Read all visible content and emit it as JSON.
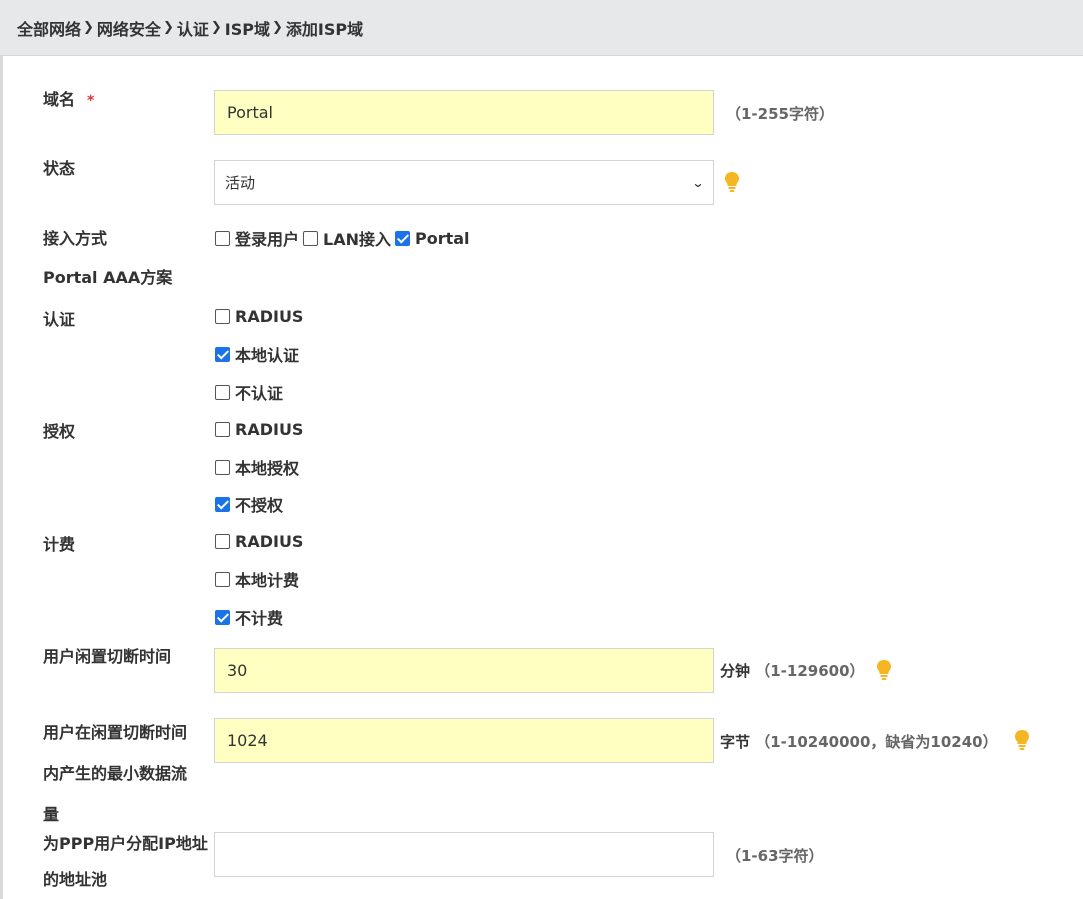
{
  "breadcrumb": [
    "全部网络",
    "网络安全",
    "认证",
    "ISP域",
    "添加ISP域"
  ],
  "breadcrumb_separator": "❯",
  "domain_name": {
    "label": "域名",
    "required_mark": "*",
    "value": "Portal",
    "hint": "（1-255字符）"
  },
  "status": {
    "label": "状态",
    "selected": "活动"
  },
  "access_method": {
    "label": "接入方式",
    "options": [
      {
        "label": "登录用户",
        "checked": false
      },
      {
        "label": "LAN接入",
        "checked": false
      },
      {
        "label": "Portal",
        "checked": true
      }
    ]
  },
  "portal_aaa": {
    "label": "Portal AAA方案"
  },
  "authentication": {
    "label": "认证",
    "options": [
      {
        "label": "RADIUS",
        "checked": false
      },
      {
        "label": "本地认证",
        "checked": true
      },
      {
        "label": "不认证",
        "checked": false
      }
    ]
  },
  "authorization": {
    "label": "授权",
    "options": [
      {
        "label": "RADIUS",
        "checked": false
      },
      {
        "label": "本地授权",
        "checked": false
      },
      {
        "label": "不授权",
        "checked": true
      }
    ]
  },
  "accounting": {
    "label": "计费",
    "options": [
      {
        "label": "RADIUS",
        "checked": false
      },
      {
        "label": "本地计费",
        "checked": false
      },
      {
        "label": "不计费",
        "checked": true
      }
    ]
  },
  "idle_cut_time": {
    "label": "用户闲置切断时间",
    "value": "30",
    "unit": "分钟",
    "hint": "（1-129600）"
  },
  "idle_min_traffic": {
    "label_lines": [
      "用户在闲置切断时间",
      "内产生的最小数据流",
      "量"
    ],
    "value": "1024",
    "unit": "字节",
    "hint": "（1-10240000，缺省为10240）"
  },
  "ppp_pool": {
    "label_lines": [
      "为PPP用户分配IP地址",
      "的地址池"
    ],
    "value": "",
    "hint": "（1-63字符）"
  },
  "colors": {
    "input_highlight": "#ffffc2",
    "checkbox_checked": "#1a73e8",
    "required": "#d9343b",
    "bulb": "#f5b623"
  }
}
